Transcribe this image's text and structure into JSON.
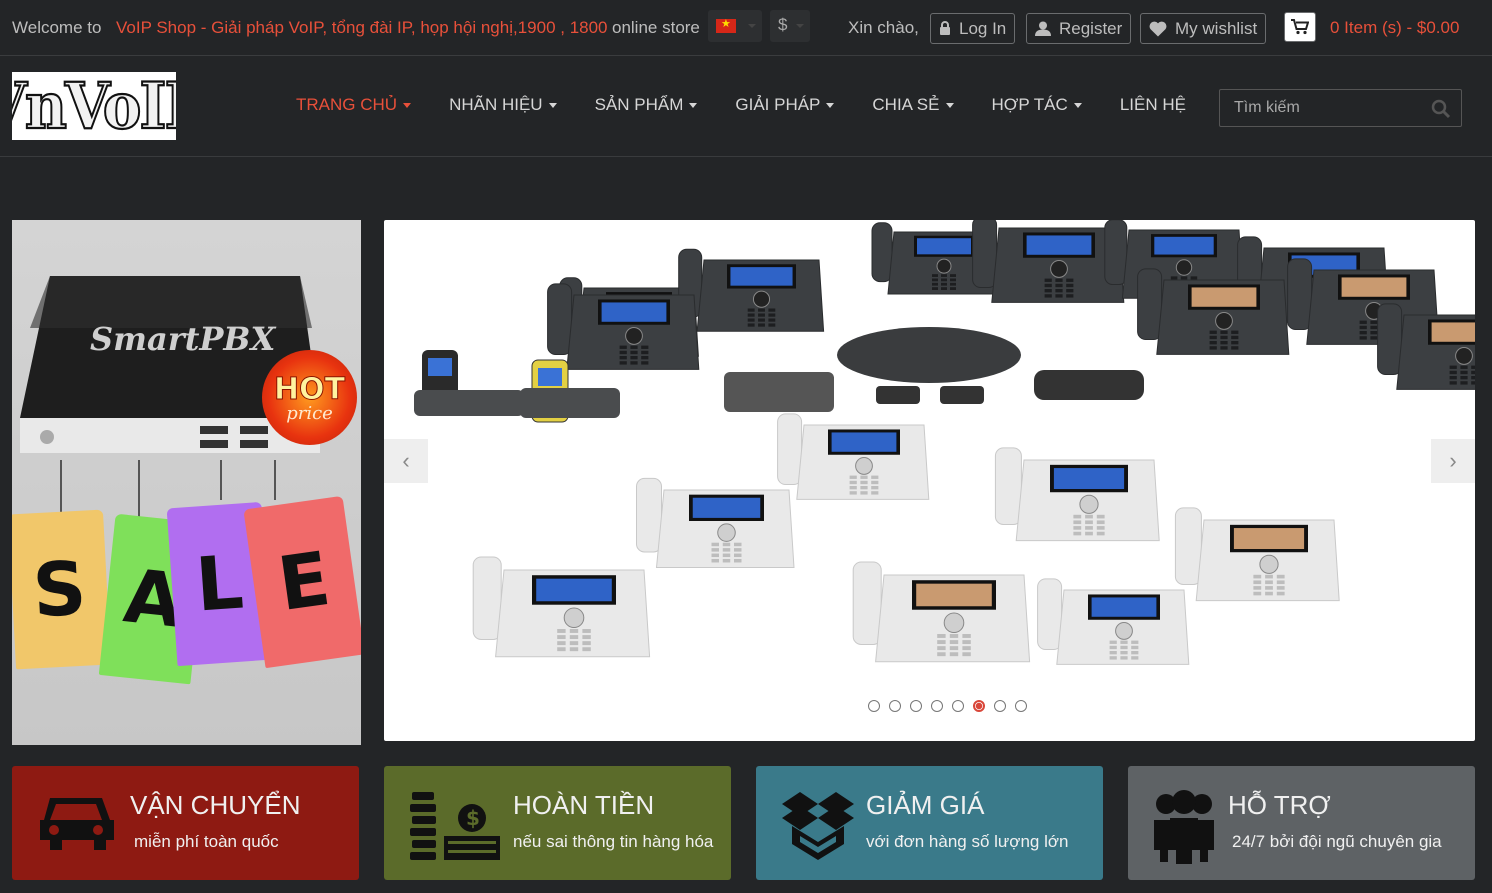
{
  "topbar": {
    "welcome": "Welcome to",
    "shop_name": "VoIP Shop - Giải pháp VoIP, tổng đài IP, họp hội nghị,1900 , 1800",
    "store": "online store",
    "currency_symbol": "$",
    "greeting": "Xin chào,",
    "login": "Log In",
    "register": "Register",
    "wishlist": "My wishlist",
    "cart_summary": "0 Item (s) - $0.00"
  },
  "header": {
    "logo_text": "VnVoIP",
    "nav": [
      {
        "label": "TRANG CHỦ",
        "dropdown": true,
        "active": true
      },
      {
        "label": "NHÃN HIỆU",
        "dropdown": true
      },
      {
        "label": "SẢN PHẨM",
        "dropdown": true
      },
      {
        "label": "GIẢI PHÁP",
        "dropdown": true
      },
      {
        "label": "CHIA SẺ",
        "dropdown": true
      },
      {
        "label": "HỢP TÁC",
        "dropdown": true
      },
      {
        "label": "LIÊN HỆ",
        "dropdown": false
      }
    ],
    "search_placeholder": "Tìm kiếm"
  },
  "promo": {
    "product": "SmartPBX",
    "hot_1": "HOT",
    "hot_2": "price",
    "sale_letters": [
      "S",
      "A",
      "L",
      "E"
    ]
  },
  "slider": {
    "slide_count": 8,
    "active_slide": 6
  },
  "features": [
    {
      "title": "VẬN CHUYỂN",
      "subtitle": "miễn phí toàn quốc",
      "color": "#8e1a12",
      "icon": "car-icon"
    },
    {
      "title": "HOÀN TIỀN",
      "subtitle": "nếu sai thông tin hàng hóa",
      "color": "#5b6b2a",
      "icon": "money-icon"
    },
    {
      "title": "GIẢM GIÁ",
      "subtitle": "với đơn hàng số lượng lớn",
      "color": "#3a7a8a",
      "icon": "box-icon"
    },
    {
      "title": "HỖ TRỢ",
      "subtitle": "24/7 bởi đội ngũ chuyên gia",
      "color": "#5e6265",
      "icon": "team-icon"
    }
  ],
  "colors": {
    "accent": "#e8503a",
    "background": "#232527"
  }
}
